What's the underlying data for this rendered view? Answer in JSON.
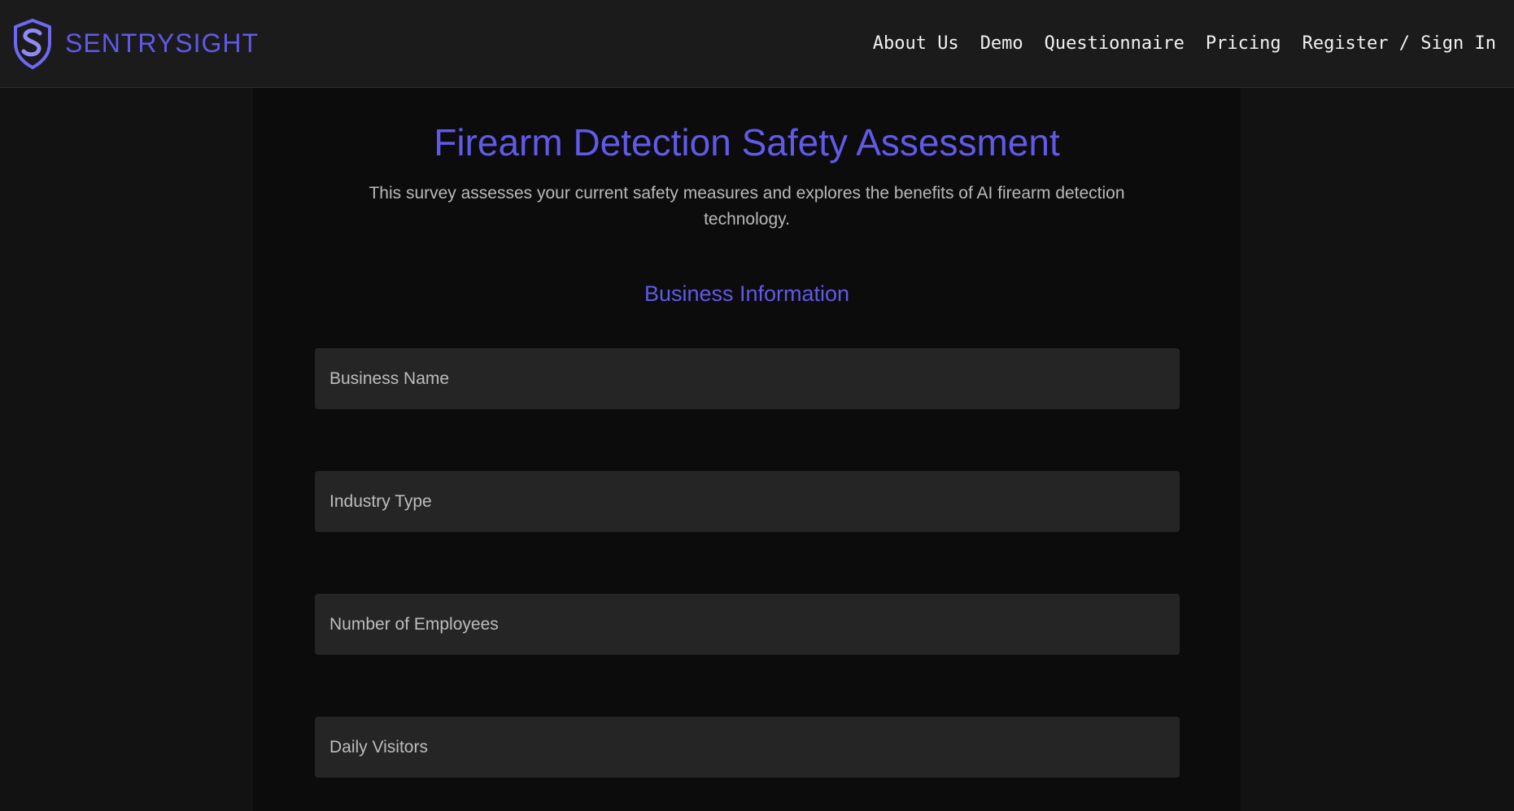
{
  "brand": {
    "name": "SENTRYSIGHT",
    "accent_color": "#6159e8",
    "logo_icon": "shield-s-logo-icon"
  },
  "nav": {
    "items": [
      {
        "label": "About Us"
      },
      {
        "label": "Demo"
      },
      {
        "label": "Questionnaire"
      },
      {
        "label": "Pricing"
      },
      {
        "label": "Register / Sign In"
      }
    ]
  },
  "main": {
    "title": "Firearm Detection Safety Assessment",
    "subtitle": "This survey assesses your current safety measures and explores the benefits of AI firearm detection technology.",
    "section_title": "Business Information",
    "fields": [
      {
        "placeholder": "Business Name",
        "value": ""
      },
      {
        "placeholder": "Industry Type",
        "value": ""
      },
      {
        "placeholder": "Number of Employees",
        "value": ""
      },
      {
        "placeholder": "Daily Visitors",
        "value": ""
      }
    ]
  }
}
